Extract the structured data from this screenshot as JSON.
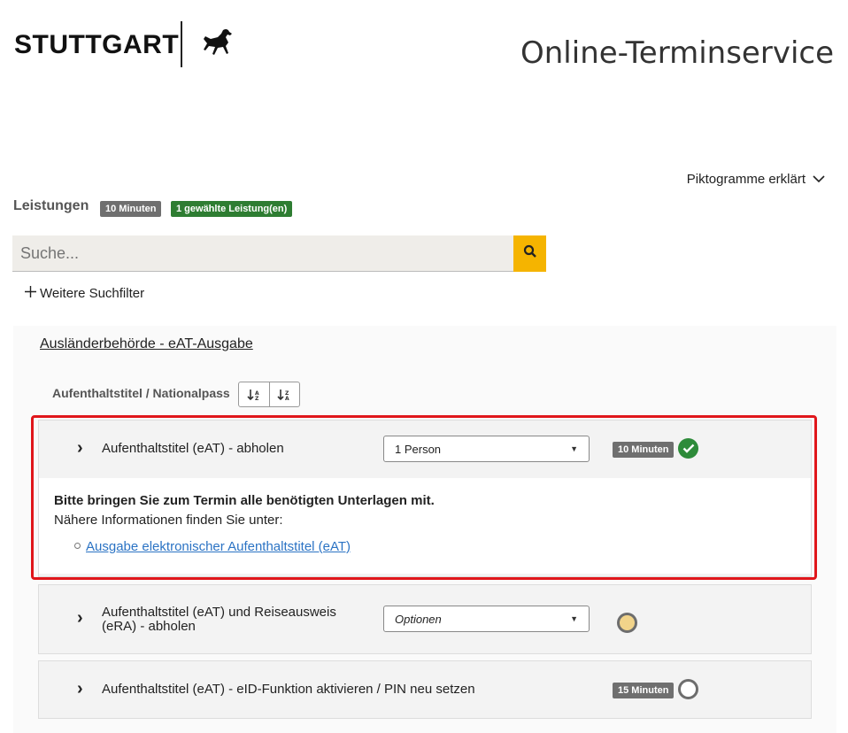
{
  "header": {
    "logo_text": "STUTTGART",
    "site_title": "Online-Terminservice"
  },
  "pictograms": {
    "label": "Piktogramme erklärt"
  },
  "services_header": {
    "title": "Leistungen",
    "duration_badge": "10 Minuten",
    "selected_badge": "1 gewählte Leistung(en)"
  },
  "search": {
    "placeholder": "Suche...",
    "icon": "search-icon"
  },
  "filters": {
    "more_label": "Weitere Suchfilter"
  },
  "category": {
    "title": "Ausländerbehörde - eAT-Ausgabe"
  },
  "group": {
    "title": "Aufenthaltstitel / Nationalpass",
    "sort_asc_label": "↓ᴬ",
    "sort_desc_label": "↓ᶻ"
  },
  "services": [
    {
      "label": "Aufenthaltstitel (eAT) - abholen",
      "select_value": "1 Person",
      "duration": "10 Minuten",
      "status": "selected"
    },
    {
      "label_line1": "Aufenthaltstitel (eAT) und Reiseausweis",
      "label_line2": "(eRA) - abholen",
      "select_value": "Optionen",
      "status": "partial"
    },
    {
      "label": "Aufenthaltstitel (eAT) - eID-Funktion aktivieren / PIN neu setzen",
      "duration": "15 Minuten",
      "status": "unselected"
    }
  ],
  "details": {
    "bold_text": "Bitte bringen Sie zum Termin alle benötigten Unterlagen mit.",
    "info_text": "Nähere Informationen finden Sie unter:",
    "link_text": "Ausgabe elektronischer Aufenthaltstitel (eAT)"
  },
  "colors": {
    "accent_yellow": "#f5b400",
    "success_green": "#2e8b3a",
    "highlight_red": "#e0161b",
    "partial_fill": "#f2d48a",
    "link_blue": "#2b73c4"
  }
}
